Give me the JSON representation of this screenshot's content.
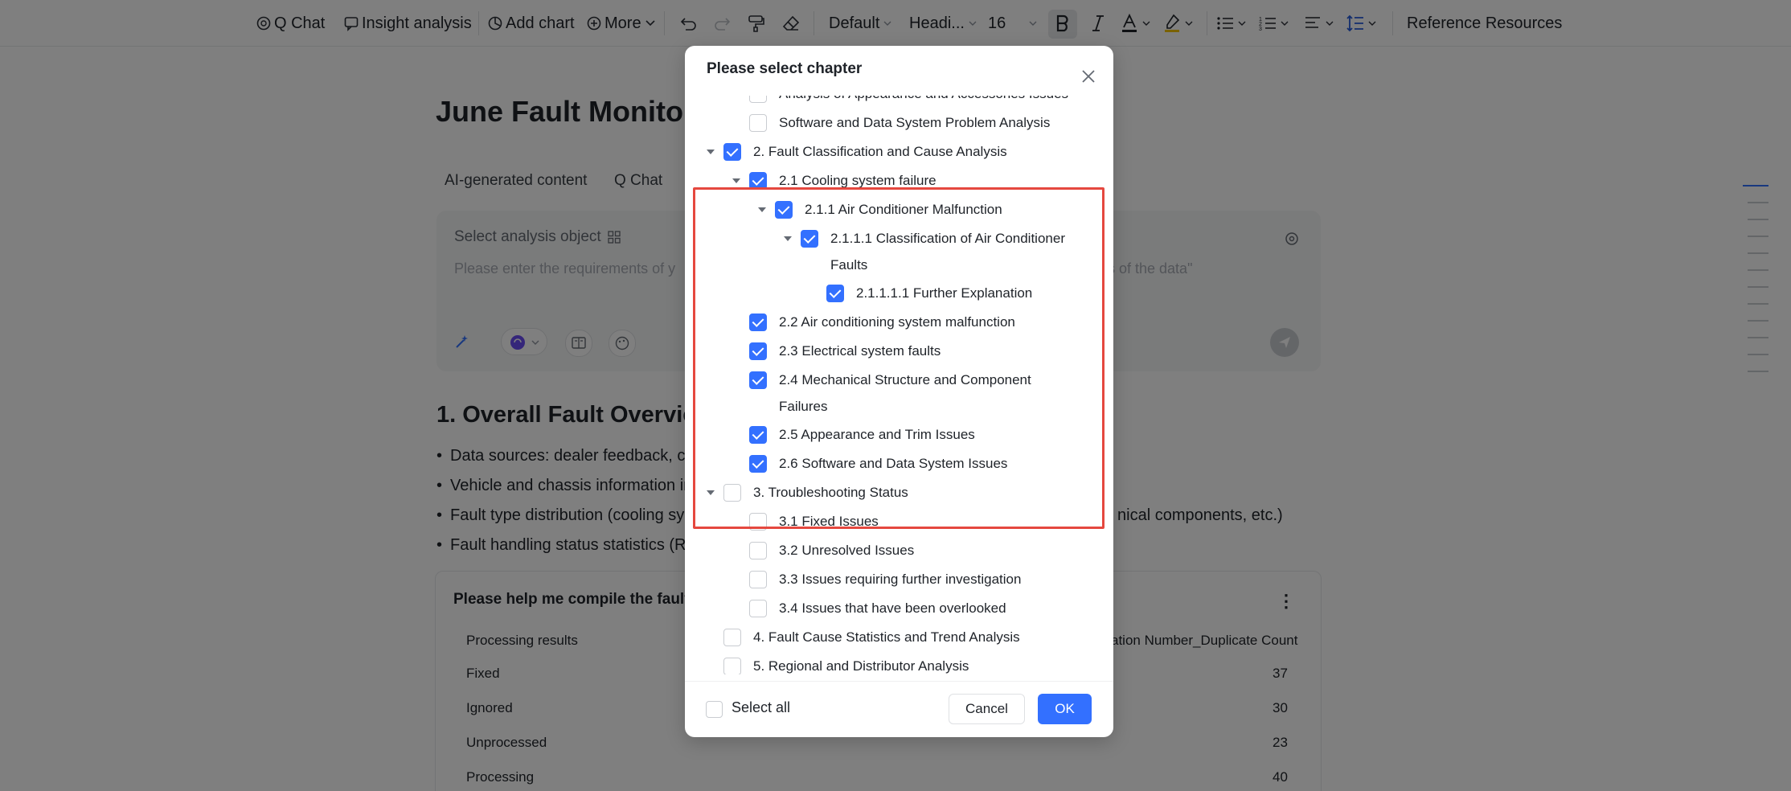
{
  "toolbar": {
    "q_chat": "Q Chat",
    "insight_analysis": "Insight analysis",
    "add_chart": "Add chart",
    "more": "More",
    "style_default": "Default",
    "heading": "Headi...",
    "font_size": "16",
    "reference_resources": "Reference Resources"
  },
  "document": {
    "title": "June Fault Monitor",
    "tabs": [
      "AI-generated content",
      "Q Chat"
    ],
    "analysis": {
      "select_object": "Select analysis object",
      "placeholder": "Please enter the requirements of y",
      "placeholder_tail": "sis of the data\""
    },
    "section_heading": "1. Overall Fault Overvie",
    "bullets": [
      "Data sources: dealer feedback, cu",
      "Vehicle and chassis information in",
      "Fault type distribution (cooling sy",
      "Fault handling status statistics (R"
    ],
    "bullet_tail": "nical components, etc.)",
    "table": {
      "title": "Please help me compile the fault",
      "col_left": "Processing results",
      "col_right": "ation Number_Duplicate Count",
      "rows": [
        {
          "label": "Fixed",
          "value": "37"
        },
        {
          "label": "Ignored",
          "value": "30"
        },
        {
          "label": "Unprocessed",
          "value": "23"
        },
        {
          "label": "Processing",
          "value": "40"
        }
      ]
    }
  },
  "modal": {
    "title": "Please select chapter",
    "tree": [
      {
        "label": "Analysis of Appearance and Accessories Issues",
        "checked": false
      },
      {
        "label": "Software and Data System Problem Analysis",
        "checked": false
      },
      {
        "label": "2. Fault Classification and Cause Analysis",
        "checked": true
      },
      {
        "label": "2.1 Cooling system failure",
        "checked": true
      },
      {
        "label": "2.1.1 Air Conditioner Malfunction",
        "checked": true
      },
      {
        "label": "2.1.1.1 Classification of Air Conditioner",
        "label_line2": "Faults",
        "checked": true
      },
      {
        "label": "2.1.1.1.1 Further Explanation",
        "checked": true
      },
      {
        "label": "2.2 Air conditioning system malfunction",
        "checked": true
      },
      {
        "label": "2.3 Electrical system faults",
        "checked": true
      },
      {
        "label": "2.4 Mechanical Structure and Component",
        "label_line2": "Failures",
        "checked": true
      },
      {
        "label": "2.5 Appearance and Trim Issues",
        "checked": true
      },
      {
        "label": "2.6 Software and Data System Issues",
        "checked": true
      },
      {
        "label": "3. Troubleshooting Status",
        "checked": false
      },
      {
        "label": "3.1 Fixed Issues",
        "checked": false
      },
      {
        "label": "3.2 Unresolved Issues",
        "checked": false
      },
      {
        "label": "3.3 Issues requiring further investigation",
        "checked": false
      },
      {
        "label": "3.4 Issues that have been overlooked",
        "checked": false
      },
      {
        "label": "4. Fault Cause Statistics and Trend Analysis",
        "checked": false
      },
      {
        "label": "5. Regional and Distributor Analysis",
        "checked": false
      }
    ],
    "select_all": "Select all",
    "cancel": "Cancel",
    "ok": "OK"
  },
  "colors": {
    "accent": "#3370ff",
    "highlight": "#e5483f"
  }
}
